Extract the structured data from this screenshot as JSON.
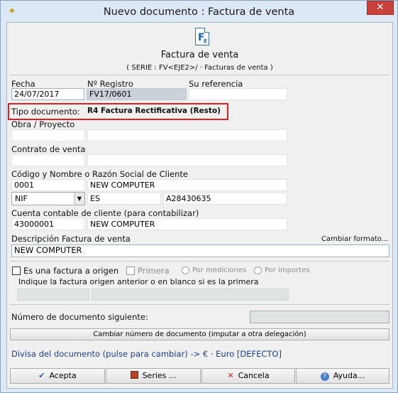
{
  "window": {
    "title": "Nuevo documento : Factura de venta",
    "close_label": "✕"
  },
  "header": {
    "doc_type_title": "Factura de venta",
    "series_line": "( SERIE : FV<EJE2>/ · Facturas de venta )",
    "icon_letter": "F",
    "icon_sub": "E"
  },
  "fields": {
    "fecha_label": "Fecha",
    "fecha_value": "24/07/2017",
    "registro_label": "Nº Registro",
    "registro_value": "FV17/0601",
    "referencia_label": "Su referencia",
    "referencia_value": "",
    "tipo_label": "Tipo documento:",
    "tipo_value": "R4 Factura Rectificativa (Resto)",
    "obra_label": "Obra / Proyecto",
    "contrato_label": "Contrato de venta",
    "cliente_label": "Código y Nombre o Razón Social de Cliente",
    "cliente_code": "0001",
    "cliente_name": "NEW COMPUTER",
    "id_type": "NIF",
    "country": "ES",
    "nif_value": "A28430635",
    "cuenta_label": "Cuenta contable de cliente (para contabilizar)",
    "cuenta_code": "43000001",
    "cuenta_name": "NEW COMPUTER",
    "descripcion_label": "Descripción Factura de venta",
    "cambiar_formato": "Cambiar formato...",
    "descripcion_value": "NEW COMPUTER"
  },
  "origin": {
    "es_factura_origen": "Es una factura a origen",
    "primera": "Primera",
    "por_mediciones": "Por mediciones",
    "por_importes": "Por importes",
    "indique_text": "Indique la factura origen anterior o en blanco si es la primera"
  },
  "numbering": {
    "siguiente_label": "Número de documento siguiente:",
    "cambiar_numero": "Cambiar número de documento (imputar a otra delegación)"
  },
  "divisa_text": "Divisa del documento (pulse para cambiar) -> € · Euro [DEFECTO]",
  "buttons": {
    "acepta": "Acepta",
    "series": "Series ...",
    "cancela": "Cancela",
    "ayuda": "Ayuda..."
  },
  "colors": {
    "highlight": "#e02020",
    "divisa_link": "#1f3f8c",
    "cancel_icon": "#d02020",
    "accept_icon": "#2a5fb0"
  }
}
